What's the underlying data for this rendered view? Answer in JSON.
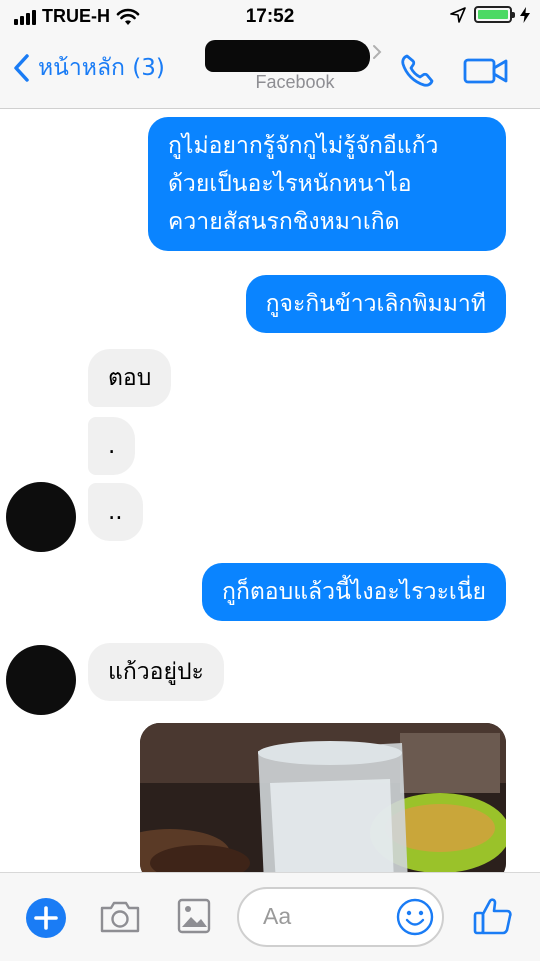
{
  "status_bar": {
    "carrier": "TRUE-H",
    "time": "17:52",
    "battery_level": 1.0
  },
  "nav": {
    "back_label": "หน้าหลัก (3)",
    "subtitle": "Facebook",
    "icons": [
      "chevron-left-icon",
      "phone-icon",
      "video-icon"
    ]
  },
  "messages": [
    {
      "from": "me",
      "text": "กูไม่อยากรู้จักกูไม่รู้จักอีแก้ว\nด้วยเป็นอะไรหนักหนาไอ\nควายสัสนรกชิงหมาเกิด"
    },
    {
      "from": "me",
      "text": "กูจะกินข้าวเลิกพิมมาที"
    },
    {
      "from": "them",
      "text": "ตอบ"
    },
    {
      "from": "them",
      "text": "."
    },
    {
      "from": "them",
      "text": ".."
    },
    {
      "from": "me",
      "text": "กูก็ตอบแล้วนี้ไงอะไรวะเนี่ย"
    },
    {
      "from": "them",
      "text": "แก้วอยู่ปะ"
    },
    {
      "from": "them",
      "type": "photo"
    }
  ],
  "composer": {
    "placeholder": "Aa",
    "icons": [
      "plus-icon",
      "camera-icon",
      "image-icon",
      "emoji-icon",
      "like-icon"
    ]
  },
  "colors": {
    "accent": "#1a7cf5",
    "outgoing_bubble": "#0a84ff",
    "incoming_bubble": "#f0f0f0",
    "battery": "#4cd964"
  }
}
